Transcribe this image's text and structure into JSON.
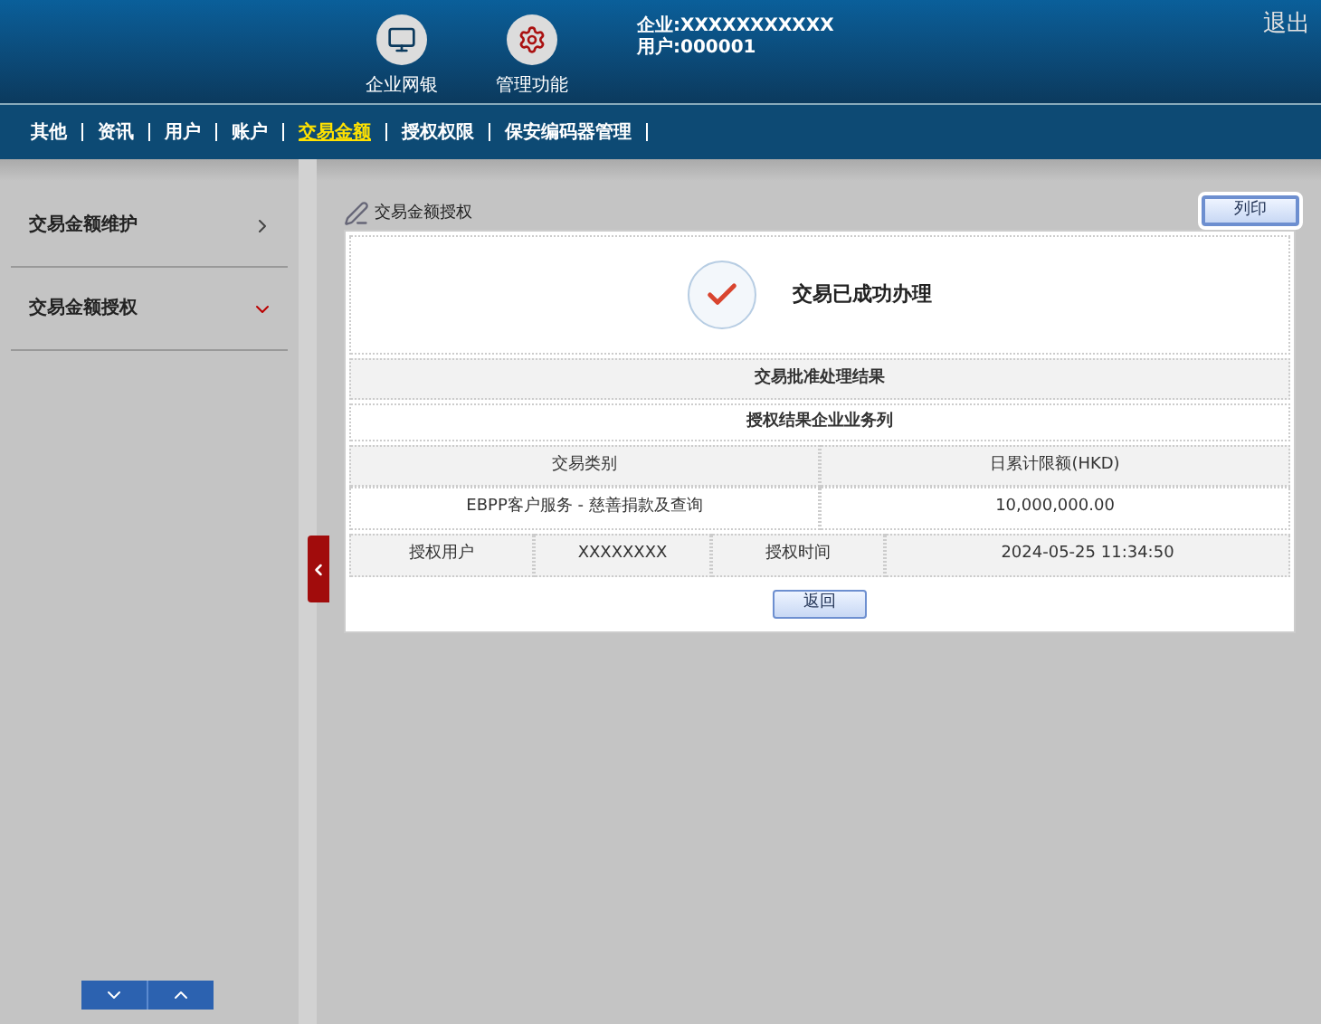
{
  "header": {
    "apps": [
      {
        "label": "企业网银",
        "kind": "monitor"
      },
      {
        "label": "管理功能",
        "kind": "gears"
      }
    ],
    "company": "企业:XXXXXXXXXXX",
    "user": "用户:000001",
    "logout": "退出"
  },
  "nav": [
    {
      "label": "其他",
      "selected": false
    },
    {
      "label": "资讯",
      "selected": false
    },
    {
      "label": "用户",
      "selected": false
    },
    {
      "label": "账户",
      "selected": false
    },
    {
      "label": "交易金额",
      "selected": true
    },
    {
      "label": "授权权限",
      "selected": false
    },
    {
      "label": "保安编码器管理",
      "selected": false
    }
  ],
  "sidebar": {
    "items": [
      {
        "label": "交易金额维护",
        "expanded": false
      },
      {
        "label": "交易金额授权",
        "expanded": true
      }
    ]
  },
  "content": {
    "title": "交易金额授权",
    "print": "列印",
    "success": "交易已成功办理",
    "section_title": "交易批准处理结果",
    "subsection_title": "授权结果企业业务列",
    "columns": [
      "交易类别",
      "日累计限额(HKD)"
    ],
    "row": [
      "EBPP客户服务 - 慈善捐款及查询",
      "10,000,000.00"
    ],
    "auth": [
      "授权用户",
      "XXXXXXXX",
      "授权时间",
      "2024-05-25 11:34:50"
    ],
    "back": "返回"
  }
}
